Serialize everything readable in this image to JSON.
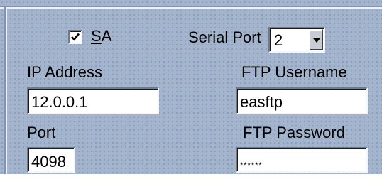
{
  "sa": {
    "checked": true,
    "label_mnemonic": "S",
    "label_rest": "A"
  },
  "serial_port": {
    "label": "Serial Port",
    "value": "2"
  },
  "ip_address": {
    "label": "IP Address",
    "value": "12.0.0.1"
  },
  "port": {
    "label": "Port",
    "value": "4098"
  },
  "ftp_username": {
    "label": "FTP Username",
    "value": "easftp"
  },
  "ftp_password": {
    "label": "FTP Password",
    "value": "******"
  },
  "icons": {
    "checkbox": "check-mark-icon",
    "dropdown": "chevron-down-icon"
  }
}
